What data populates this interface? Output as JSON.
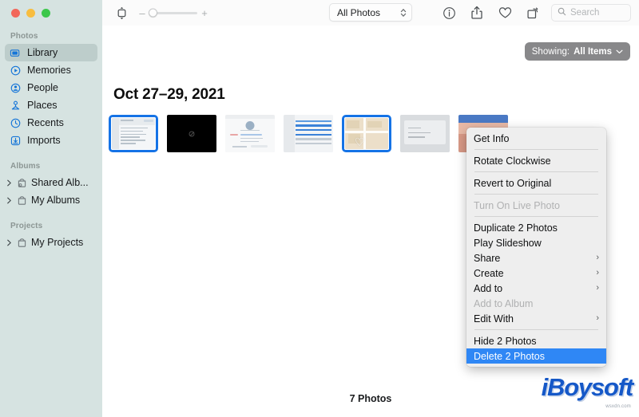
{
  "window": {
    "traffic_lights": [
      "close",
      "minimize",
      "zoom"
    ]
  },
  "sidebar": {
    "sections": [
      {
        "title": "Photos",
        "items": [
          {
            "label": "Library",
            "icon": "library-icon",
            "active": true
          },
          {
            "label": "Memories",
            "icon": "memories-icon",
            "active": false
          },
          {
            "label": "People",
            "icon": "people-icon",
            "active": false
          },
          {
            "label": "Places",
            "icon": "places-icon",
            "active": false
          },
          {
            "label": "Recents",
            "icon": "recents-icon",
            "active": false
          },
          {
            "label": "Imports",
            "icon": "imports-icon",
            "active": false
          }
        ]
      },
      {
        "title": "Albums",
        "items": [
          {
            "label": "Shared Alb...",
            "icon": "shared-album-icon",
            "active": false
          },
          {
            "label": "My Albums",
            "icon": "album-icon",
            "active": false
          }
        ]
      },
      {
        "title": "Projects",
        "items": [
          {
            "label": "My Projects",
            "icon": "project-icon",
            "active": false
          }
        ]
      }
    ]
  },
  "toolbar": {
    "view_toggle_icon": "expand-collapse-icon",
    "zoom_out_label": "–",
    "zoom_in_label": "+",
    "zoom_value": 0,
    "view_popup": {
      "label": "All Photos",
      "icon": "updown-chevrons-icon"
    },
    "icons": [
      {
        "name": "info-icon",
        "glyph": "i"
      },
      {
        "name": "share-icon",
        "glyph": "share"
      },
      {
        "name": "favorite-icon",
        "glyph": "heart"
      },
      {
        "name": "rotate-icon",
        "glyph": "rotate"
      }
    ],
    "search": {
      "placeholder": "Search",
      "value": "",
      "icon": "search-icon"
    }
  },
  "content": {
    "showing_button": {
      "lead": "Showing:",
      "value": "All Items",
      "chevron": "chevron-down-icon"
    },
    "date_heading": "Oct 27–29, 2021",
    "status": "7 Photos",
    "thumbnails": [
      {
        "kind": "doc",
        "selected": true,
        "name": "photo-thumbnail-1"
      },
      {
        "kind": "black",
        "selected": false,
        "name": "photo-thumbnail-2"
      },
      {
        "kind": "mail",
        "selected": false,
        "name": "photo-thumbnail-3"
      },
      {
        "kind": "table",
        "selected": false,
        "name": "photo-thumbnail-4"
      },
      {
        "kind": "map",
        "selected": true,
        "name": "photo-thumbnail-5"
      },
      {
        "kind": "grey",
        "selected": false,
        "name": "photo-thumbnail-6"
      },
      {
        "kind": "pink",
        "selected": false,
        "name": "photo-thumbnail-7"
      }
    ]
  },
  "context_menu": {
    "items": [
      {
        "label": "Get Info",
        "type": "item",
        "name": "menu-item-get-info"
      },
      {
        "type": "separator"
      },
      {
        "label": "Rotate Clockwise",
        "type": "item",
        "name": "menu-item-rotate-clockwise"
      },
      {
        "type": "separator"
      },
      {
        "label": "Revert to Original",
        "type": "item",
        "name": "menu-item-revert-to-original"
      },
      {
        "type": "separator"
      },
      {
        "label": "Turn On Live Photo",
        "type": "disabled",
        "name": "menu-item-turn-on-live-photo"
      },
      {
        "type": "separator"
      },
      {
        "label": "Duplicate 2 Photos",
        "type": "item",
        "name": "menu-item-duplicate-2-photos"
      },
      {
        "label": "Play Slideshow",
        "type": "item",
        "name": "menu-item-play-slideshow"
      },
      {
        "label": "Share",
        "type": "submenu",
        "name": "menu-item-share"
      },
      {
        "label": "Create",
        "type": "submenu",
        "name": "menu-item-create"
      },
      {
        "label": "Add to",
        "type": "submenu",
        "name": "menu-item-add-to"
      },
      {
        "label": "Add to Album",
        "type": "disabled",
        "name": "menu-item-add-to-album"
      },
      {
        "label": "Edit With",
        "type": "submenu",
        "name": "menu-item-edit-with"
      },
      {
        "type": "separator"
      },
      {
        "label": "Hide 2 Photos",
        "type": "item",
        "name": "menu-item-hide-2-photos"
      },
      {
        "label": "Delete 2 Photos",
        "type": "highlight",
        "name": "menu-item-delete-2-photos"
      }
    ],
    "submenu_arrow": "›"
  },
  "watermark": {
    "text": "iBoysoft",
    "url": "wsxdn.com"
  },
  "colors": {
    "sidebar_bg": "#d6e3e1",
    "accent_blue": "#1573e6",
    "menu_highlight": "#2f87f5",
    "showing_bg": "#88888a",
    "watermark_blue": "#1558c8"
  }
}
